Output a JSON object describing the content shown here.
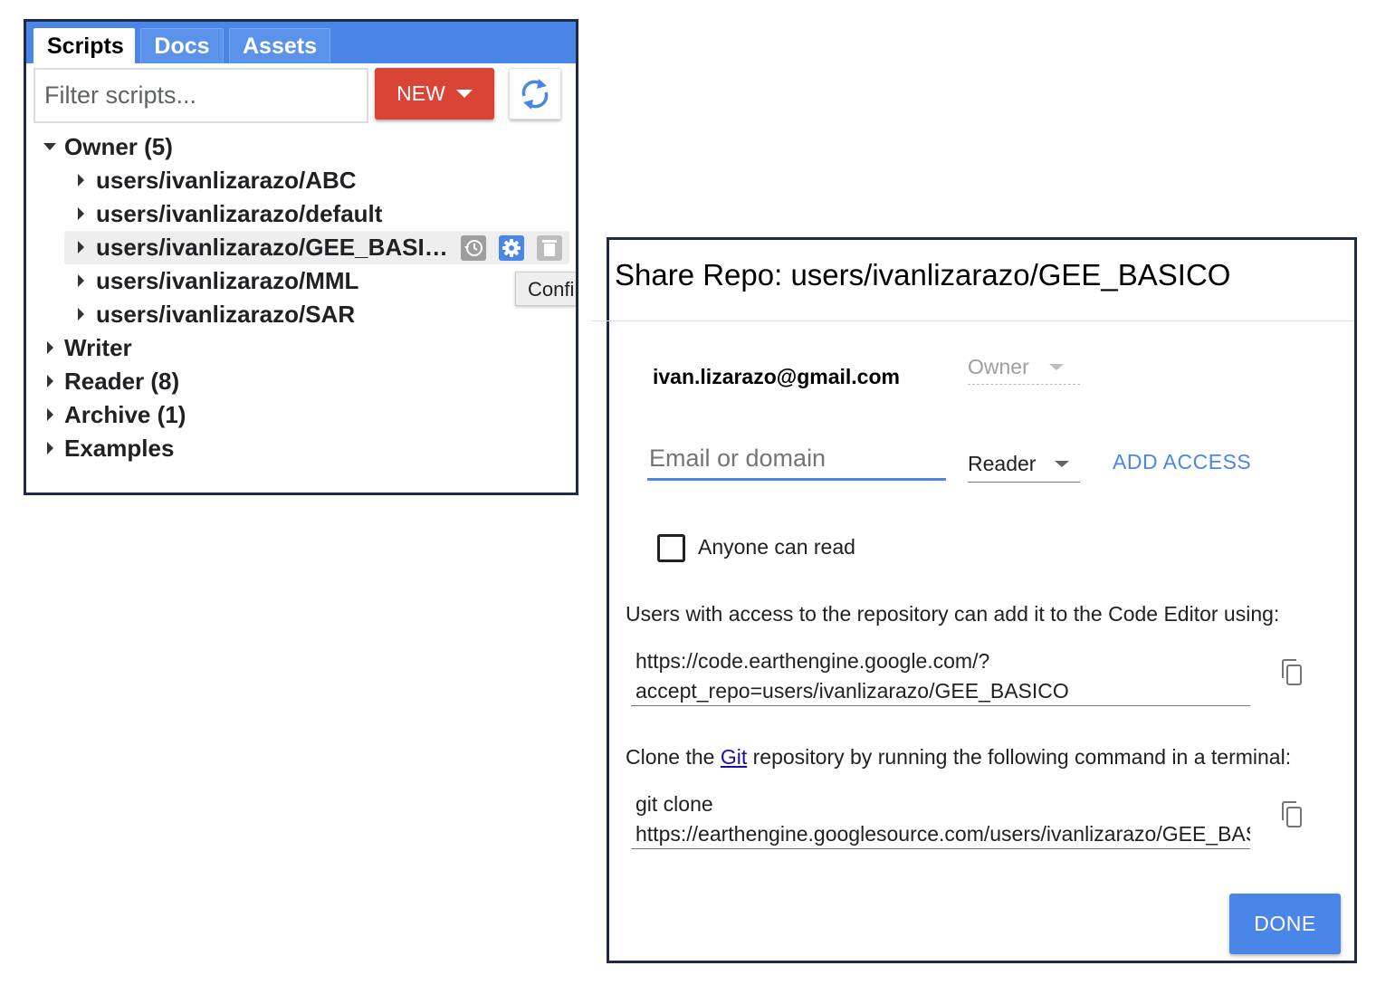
{
  "scripts_panel": {
    "tabs": [
      {
        "label": "Scripts",
        "active": true
      },
      {
        "label": "Docs",
        "active": false
      },
      {
        "label": "Assets",
        "active": false
      }
    ],
    "filter_placeholder": "Filter scripts...",
    "new_button_label": "NEW",
    "tree": {
      "owner": {
        "label": "Owner (5)",
        "expanded": true,
        "repos": [
          {
            "label": "users/ivanlizarazo/ABC"
          },
          {
            "label": "users/ivanlizarazo/default"
          },
          {
            "label": "users/ivanlizarazo/GEE_BASI…",
            "hovered": true
          },
          {
            "label": "users/ivanlizarazo/MML"
          },
          {
            "label": "users/ivanlizarazo/SAR"
          }
        ]
      },
      "groups": [
        {
          "label": "Writer"
        },
        {
          "label": "Reader (8)"
        },
        {
          "label": "Archive (1)"
        },
        {
          "label": "Examples"
        }
      ]
    },
    "row_icons": [
      "history-icon",
      "gear-icon",
      "trash-icon"
    ],
    "tooltip_text": "Confi"
  },
  "share_dialog": {
    "title": "Share Repo: users/ivanlizarazo/GEE_BASICO",
    "owner": {
      "email": "ivan.lizarazo@gmail.com",
      "role": "Owner"
    },
    "email_placeholder": "Email or domain",
    "role_selected": "Reader",
    "add_access_label": "ADD ACCESS",
    "anyone_can_read_label": "Anyone can read",
    "anyone_can_read_checked": false,
    "code_editor_info": "Users with access to the repository can add it to the Code Editor using:",
    "accept_repo_url": "https://code.earthengine.google.com/?accept_repo=users/ivanlizarazo/GEE_BASICO",
    "clone_prefix": "Clone the ",
    "clone_link_text": "Git",
    "clone_suffix": " repository by running the following command in a terminal:",
    "clone_command": "git clone https://earthengine.googlesource.com/users/ivanlizarazo/GEE_BASICO",
    "done_label": "DONE"
  },
  "colors": {
    "tab_bar": "#4a86e8",
    "new_button": "#d94434",
    "accent_blue": "#4a86e8",
    "link": "#1a0dab"
  }
}
